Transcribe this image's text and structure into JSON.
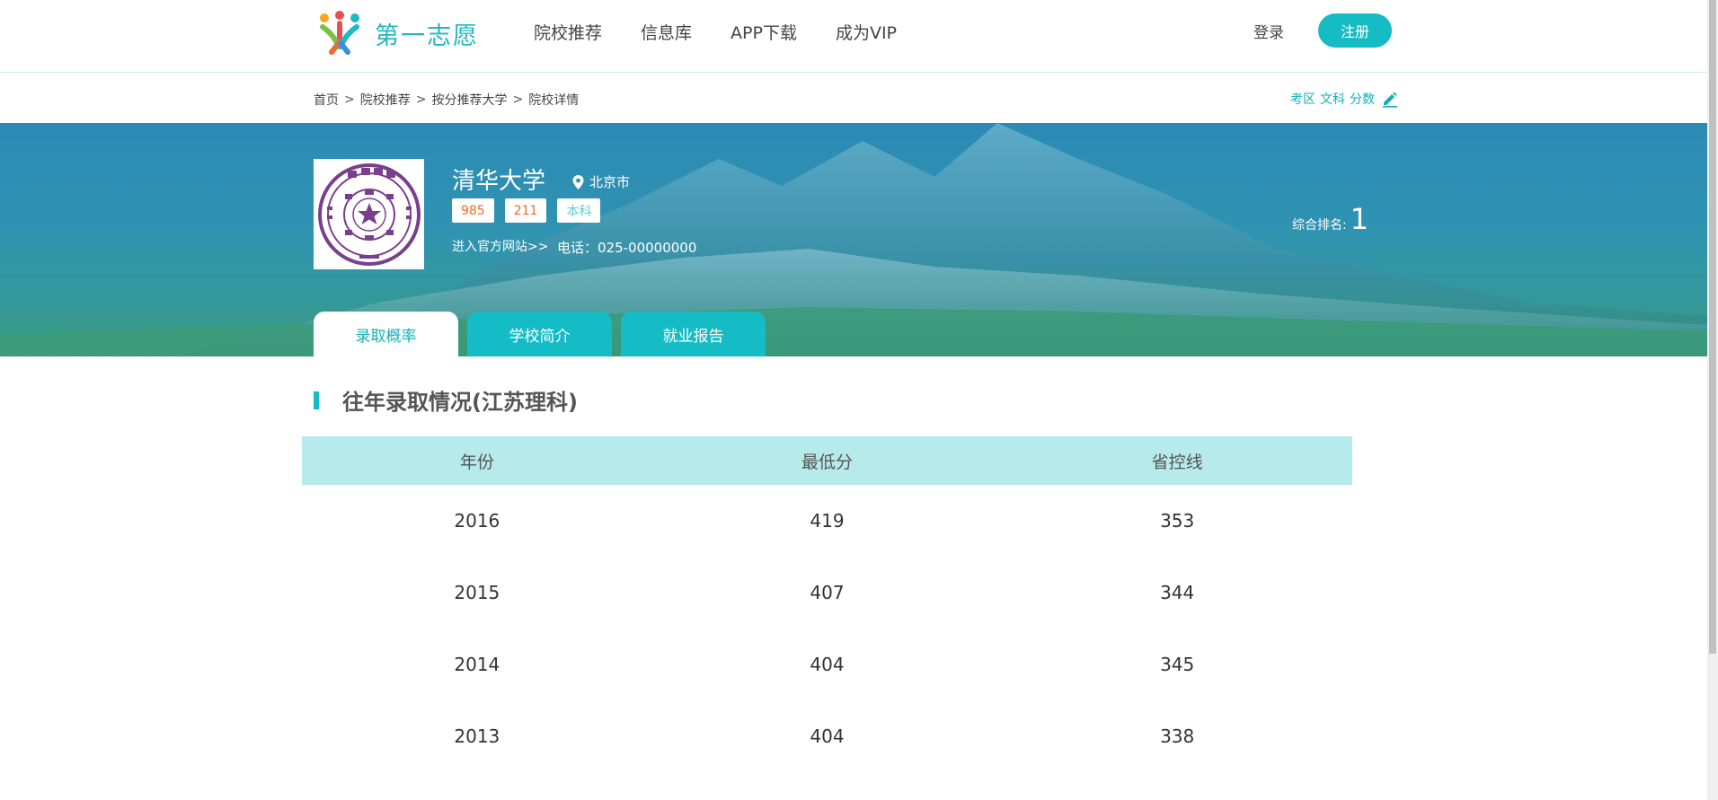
{
  "header": {
    "logo_text": "第一志愿",
    "nav": [
      "院校推荐",
      "信息库",
      "APP下载",
      "成为VIP"
    ],
    "login_label": "登录",
    "register_label": "注册"
  },
  "breadcrumb": {
    "items": [
      "首页",
      "院校推荐",
      "按分推荐大学",
      "院校详情"
    ],
    "separator": ">"
  },
  "filters": {
    "items": [
      "考区",
      "文科",
      "分数"
    ],
    "edit_icon": "edit-icon"
  },
  "school": {
    "name": "清华大学",
    "location": "北京市",
    "tags": [
      "985",
      "211",
      "本科"
    ],
    "site_link": "进入官方网站>>",
    "phone": "电话：025-00000000",
    "rank_label": "综合排名:",
    "rank_value": "1"
  },
  "tabs": [
    "录取概率",
    "学校简介",
    "就业报告"
  ],
  "section": {
    "title": "往年录取情况(江苏理科)"
  },
  "table": {
    "headers": [
      "年份",
      "最低分",
      "省控线"
    ],
    "rows": [
      [
        "2016",
        "419",
        "353"
      ],
      [
        "2015",
        "407",
        "344"
      ],
      [
        "2014",
        "404",
        "345"
      ],
      [
        "2013",
        "404",
        "338"
      ]
    ]
  },
  "colors": {
    "accent": "#16bcc3",
    "banner_top": "#2c8ab4",
    "banner_bottom": "#3a9a7c",
    "table_header_bg": "#b6eaeb",
    "tag_orange": "#f06a2a"
  }
}
